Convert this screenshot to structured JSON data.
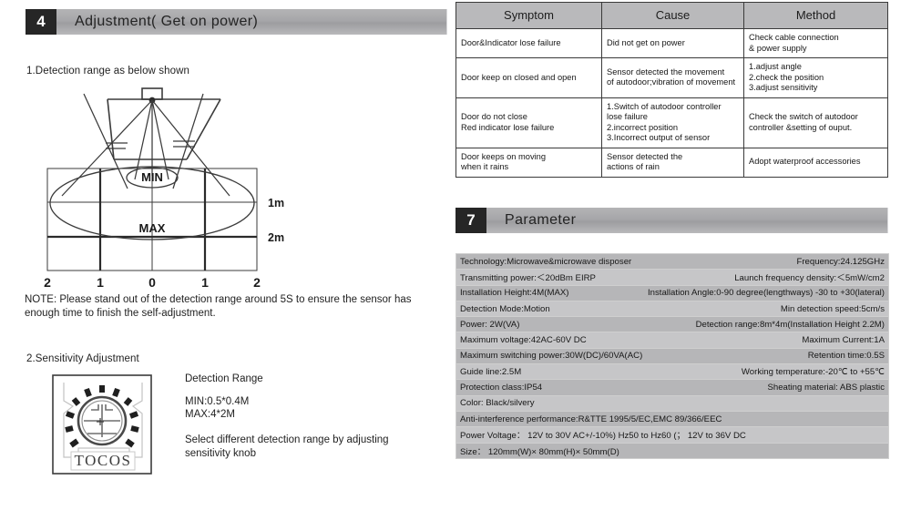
{
  "sections": {
    "adjustment": {
      "number": "4",
      "title": "Adjustment( Get on power)"
    },
    "parameter": {
      "number": "7",
      "title": "Parameter"
    }
  },
  "left": {
    "detection_heading": "1.Detection range as below shown",
    "note": "NOTE: Please stand out of the detection range around 5S to ensure the sensor has enough time to finish the self-adjustment.",
    "sensitivity_heading": "2.Sensitivity Adjustment",
    "diagram": {
      "min_label": "MIN",
      "max_label": "MAX",
      "depth_labels": [
        "1m",
        "2m"
      ],
      "axis_labels": [
        "2",
        "1",
        "0",
        "1",
        "2"
      ]
    },
    "knob": {
      "brand": "TOCOS"
    },
    "range_text": {
      "title": "Detection Range",
      "min": "MIN:0.5*0.4M",
      "max": "MAX:4*2M",
      "note_line1": "Select different detection range by adjusting",
      "note_line2": "sensitivity knob"
    }
  },
  "trouble_table": {
    "headers": [
      "Symptom",
      "Cause",
      "Method"
    ],
    "rows": [
      {
        "symptom": [
          "Door&Indicator lose failure"
        ],
        "cause": [
          "Did not get on power"
        ],
        "method": [
          "Check cable connection",
          "& power supply"
        ]
      },
      {
        "symptom": [
          "Door keep on closed and open"
        ],
        "cause": [
          "Sensor detected the movement",
          "of autodoor;vibration of movement"
        ],
        "method": [
          "1.adjust angle",
          "2.check the position",
          "3.adjust sensitivity"
        ]
      },
      {
        "symptom": [
          "Door do not close",
          "Red indicator lose failure"
        ],
        "cause": [
          "1.Switch of autodoor controller",
          "   lose failure",
          "2.incorrect position",
          "3.Incorrect output of sensor"
        ],
        "method": [
          "Check the switch of autodoor",
          "controller &setting of ouput."
        ]
      },
      {
        "symptom": [
          "Door keeps on moving",
          " when it rains"
        ],
        "cause": [
          "Sensor detected the",
          "actions of rain"
        ],
        "method": [
          "Adopt waterproof accessories"
        ]
      }
    ]
  },
  "parameters": [
    {
      "left": "Technology:Microwave&microwave disposer",
      "right": "Frequency:24.125GHz"
    },
    {
      "left": "Transmitting power:＜20dBm EIRP",
      "right": "Launch frequency density:＜5mW/cm2"
    },
    {
      "left": "Installation Height:4M(MAX)",
      "right": "Installation Angle:0-90 degree(lengthways) -30 to +30(lateral)"
    },
    {
      "left": "Detection Mode:Motion",
      "right": "Min detection speed:5cm/s"
    },
    {
      "left": "Power:  2W(VA)",
      "right": "Detection range:8m*4m(Installation Height 2.2M)"
    },
    {
      "left": "Maximum voltage:42AC-60V DC",
      "right": "Maximum Current:1A"
    },
    {
      "left": "Maximum switching power:30W(DC)/60VA(AC)",
      "right": "Retention time:0.5S"
    },
    {
      "left": "Guide line:2.5M",
      "right": "Working temperature:-20℃ to +55℃"
    },
    {
      "left": "Protection class:IP54",
      "right": "Sheating material: ABS plastic"
    },
    {
      "left": "Color: Black/silvery",
      "right": ""
    },
    {
      "left": "Anti-interference performance:R&TTE 1995/5/EC,EMC 89/366/EEC",
      "right": ""
    },
    {
      "left": "Power Voltage：  12V to 30V AC+/-10%) Hz50 to Hz60 (； 12V to 36V DC",
      "right": ""
    },
    {
      "left": "Size：  120mm(W)× 80mm(H)× 50mm(D)",
      "right": ""
    }
  ]
}
